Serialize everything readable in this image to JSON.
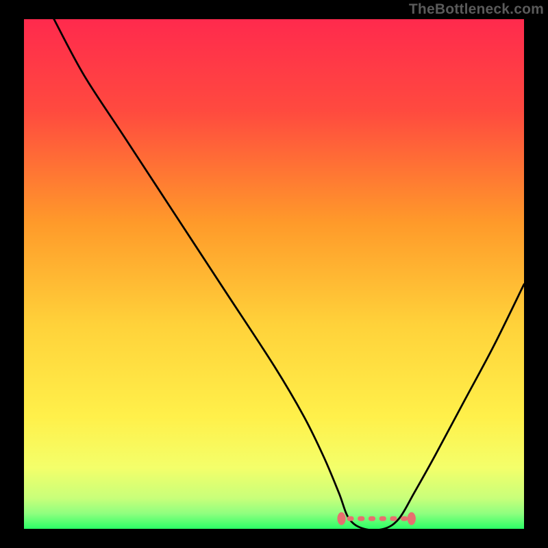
{
  "watermark": "TheBottleneck.com",
  "chart_data": {
    "type": "line",
    "title": "",
    "xlabel": "",
    "ylabel": "",
    "xlim": [
      0,
      100
    ],
    "ylim": [
      0,
      100
    ],
    "gradient_stops": [
      {
        "offset": 0,
        "color": "#ff2a4d"
      },
      {
        "offset": 18,
        "color": "#ff4a3f"
      },
      {
        "offset": 40,
        "color": "#ff9a2a"
      },
      {
        "offset": 60,
        "color": "#ffd23a"
      },
      {
        "offset": 78,
        "color": "#fff04a"
      },
      {
        "offset": 88,
        "color": "#f4ff6a"
      },
      {
        "offset": 94,
        "color": "#c8ff7a"
      },
      {
        "offset": 97,
        "color": "#8fff7f"
      },
      {
        "offset": 100,
        "color": "#2bff66"
      }
    ],
    "series": [
      {
        "name": "bottleneck-curve",
        "x": [
          6,
          12,
          20,
          30,
          40,
          50,
          56,
          60,
          63,
          65,
          68,
          72,
          75,
          78,
          82,
          88,
          94,
          100
        ],
        "values": [
          100,
          89,
          77,
          62,
          47,
          32,
          22,
          14,
          7,
          2,
          0,
          0,
          2,
          7,
          14,
          25,
          36,
          48
        ]
      }
    ],
    "plateau": {
      "x_start": 63.5,
      "x_end": 77.5,
      "y": 2,
      "endpoint_radius": 1.4,
      "dash_count": 6
    }
  }
}
